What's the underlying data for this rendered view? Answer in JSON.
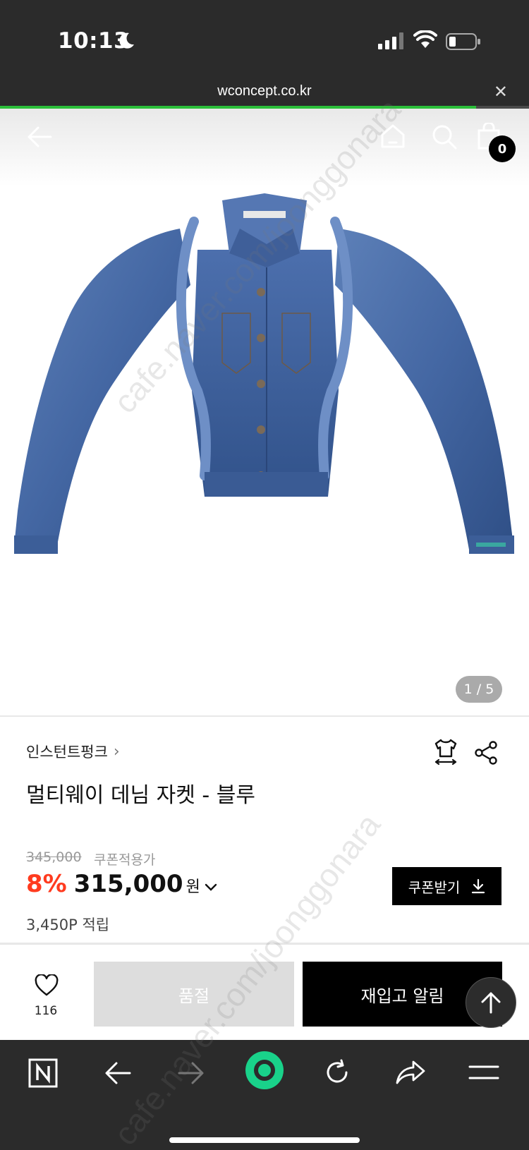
{
  "status_bar": {
    "time": "10:13"
  },
  "browser": {
    "url": "wconcept.co.kr",
    "load_progress": 0.9
  },
  "header": {
    "cart_count": "0"
  },
  "gallery": {
    "counter": "1 / 5"
  },
  "product": {
    "brand": "인스턴트펑크",
    "name": "멀티웨이 데님 자켓 - 블루",
    "original_price": "345,000",
    "coupon_note": "쿠폰적용가",
    "discount": "8%",
    "price": "315,000",
    "currency": "원",
    "points": "3,450P 적립",
    "coupon_button": "쿠폰받기"
  },
  "actions": {
    "like_count": "116",
    "soldout_label": "품절",
    "restock_label": "재입고 알림"
  },
  "colors": {
    "accent": "#ff3b1f",
    "progress": "#2bbf3a",
    "toolbar": "#2b2b2b"
  },
  "icons": [
    "moon-icon",
    "signal-icon",
    "wifi-icon",
    "battery-icon",
    "back-icon",
    "home-icon",
    "search-icon",
    "bag-icon",
    "size-icon",
    "share-icon",
    "heart-icon",
    "arrow-up-icon",
    "naver-icon",
    "forward-icon",
    "refresh-icon",
    "share-arrow-icon",
    "menu-icon"
  ],
  "watermark": "cafe.naver.com/joonggonara"
}
